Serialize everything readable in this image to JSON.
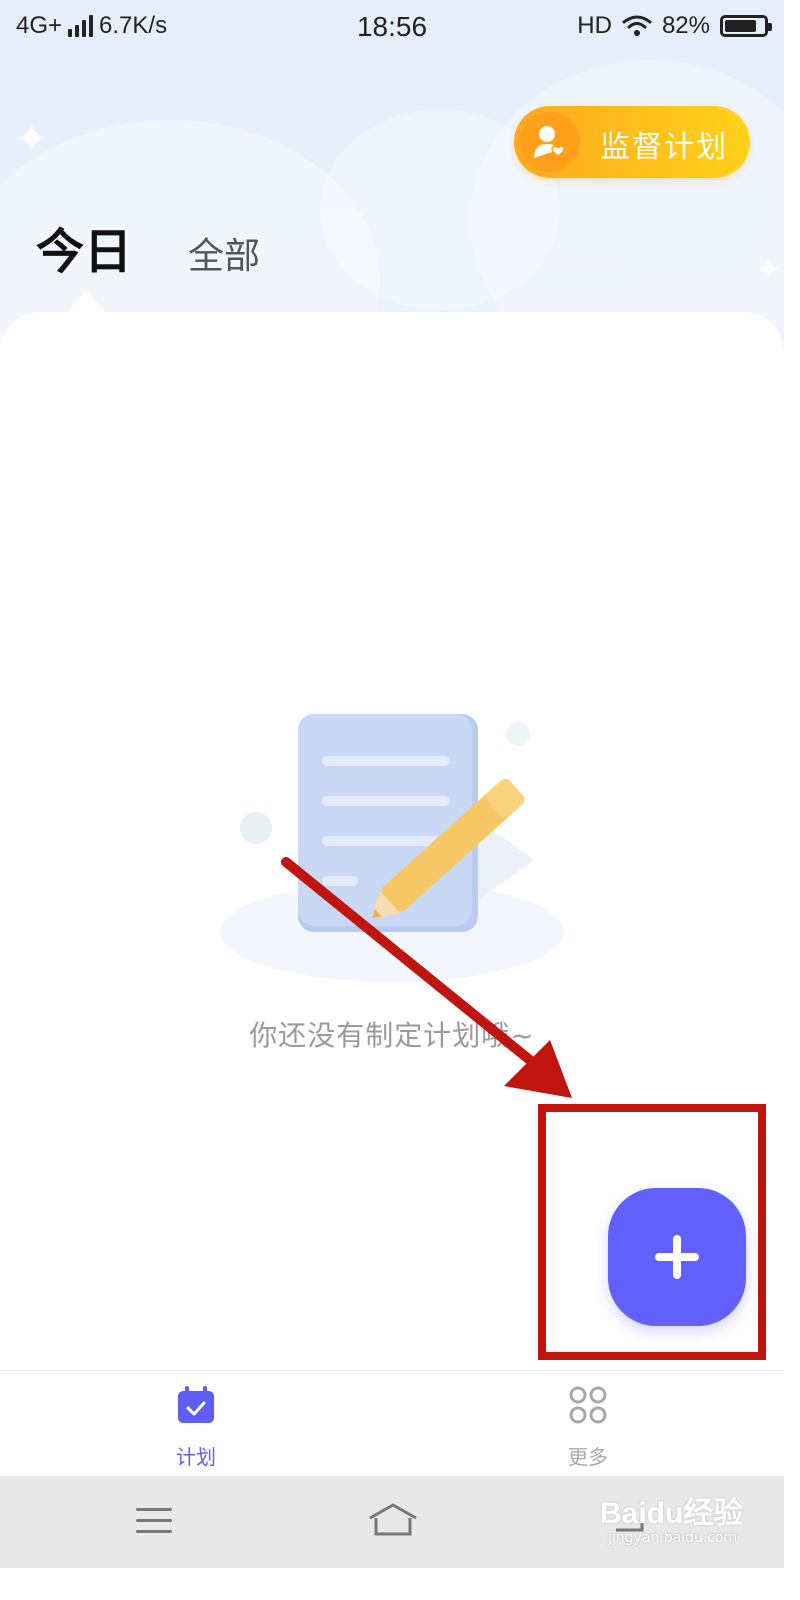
{
  "status_bar": {
    "network": "4G+",
    "speed": "6.7K/s",
    "time": "18:56",
    "hd": "HD",
    "battery": "82%",
    "battery_level": 0.82
  },
  "header": {
    "supervise_button_label": "监督计划",
    "tabs": [
      {
        "label": "今日",
        "active": true
      },
      {
        "label": "全部",
        "active": false
      }
    ]
  },
  "empty_state": {
    "message": "你还没有制定计划哦~",
    "illustration": "document-pencil-illustration"
  },
  "fab": {
    "icon": "plus-icon",
    "color": "#6160fb"
  },
  "annotation": {
    "color": "#c0140f",
    "shapes": [
      "arrow",
      "rectangle"
    ]
  },
  "bottom_nav": {
    "items": [
      {
        "label": "计划",
        "icon": "calendar-check-icon",
        "active": true
      },
      {
        "label": "更多",
        "icon": "grid-icon",
        "active": false
      }
    ]
  },
  "system_nav": {
    "icons": [
      "menu-icon",
      "home-icon",
      "back-icon"
    ]
  },
  "watermark": {
    "main": "Baidu经验",
    "sub": "jingyan.baidu.com"
  },
  "colors": {
    "accent": "#6160fb",
    "supervise_gradient_start": "#ffa81f",
    "supervise_gradient_end": "#ffd21c",
    "header_bg": "#e6eefc"
  }
}
